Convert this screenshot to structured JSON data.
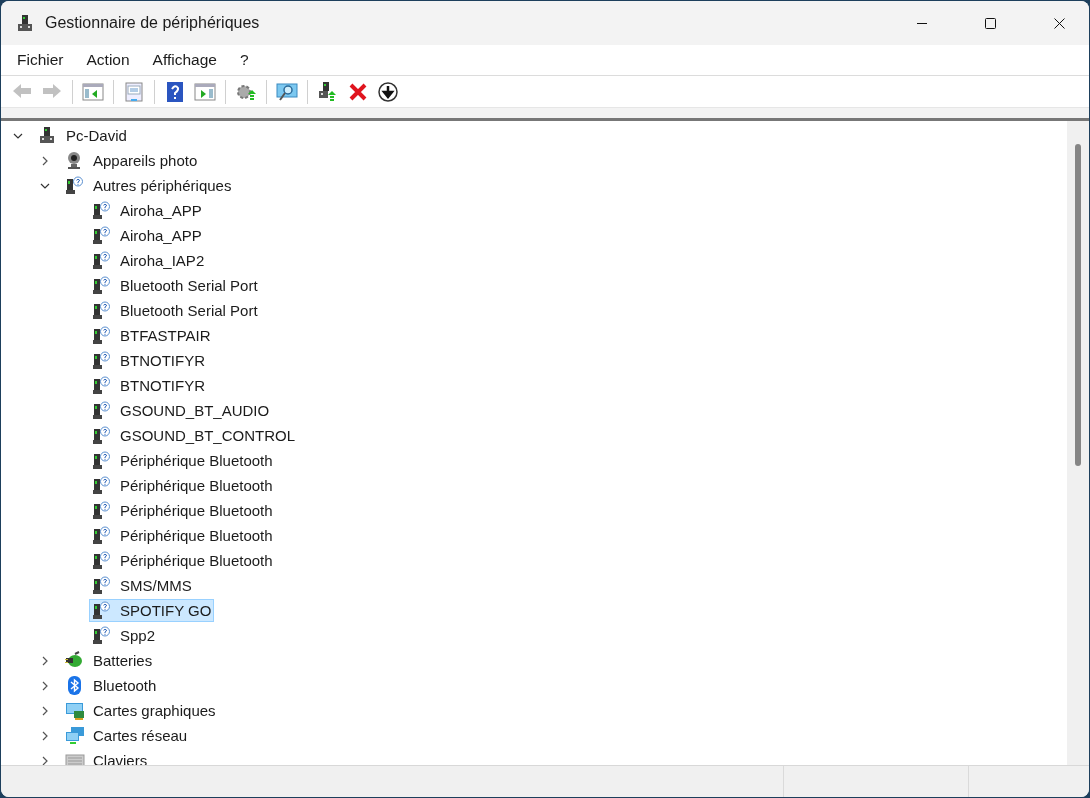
{
  "window": {
    "title": "Gestionnaire de périphériques"
  },
  "menu": [
    {
      "label": "Fichier"
    },
    {
      "label": "Action"
    },
    {
      "label": "Affichage"
    },
    {
      "label": "?"
    }
  ],
  "toolbar": [
    {
      "kind": "back",
      "disabled": true
    },
    {
      "kind": "forward",
      "disabled": true
    },
    {
      "kind": "separator"
    },
    {
      "kind": "pane-left"
    },
    {
      "kind": "separator"
    },
    {
      "kind": "properties"
    },
    {
      "kind": "separator"
    },
    {
      "kind": "help"
    },
    {
      "kind": "pane-right"
    },
    {
      "kind": "separator"
    },
    {
      "kind": "update"
    },
    {
      "kind": "separator"
    },
    {
      "kind": "scan"
    },
    {
      "kind": "separator"
    },
    {
      "kind": "enable"
    },
    {
      "kind": "remove"
    },
    {
      "kind": "download"
    }
  ],
  "tree": [
    {
      "label": "Pc-David",
      "kind": "computer",
      "expanded": true,
      "selected": false,
      "children": [
        {
          "label": "Appareils photo",
          "kind": "camera",
          "expanded": false,
          "selected": false
        },
        {
          "label": "Autres périphériques",
          "kind": "unknown",
          "expanded": true,
          "selected": false,
          "children": [
            {
              "label": "Airoha_APP",
              "kind": "unknown",
              "selected": false
            },
            {
              "label": "Airoha_APP",
              "kind": "unknown",
              "selected": false
            },
            {
              "label": "Airoha_IAP2",
              "kind": "unknown",
              "selected": false
            },
            {
              "label": "Bluetooth Serial Port",
              "kind": "unknown",
              "selected": false
            },
            {
              "label": "Bluetooth Serial Port",
              "kind": "unknown",
              "selected": false
            },
            {
              "label": "BTFASTPAIR",
              "kind": "unknown",
              "selected": false
            },
            {
              "label": "BTNOTIFYR",
              "kind": "unknown",
              "selected": false
            },
            {
              "label": "BTNOTIFYR",
              "kind": "unknown",
              "selected": false
            },
            {
              "label": "GSOUND_BT_AUDIO",
              "kind": "unknown",
              "selected": false
            },
            {
              "label": "GSOUND_BT_CONTROL",
              "kind": "unknown",
              "selected": false
            },
            {
              "label": "Périphérique Bluetooth",
              "kind": "unknown",
              "selected": false
            },
            {
              "label": "Périphérique Bluetooth",
              "kind": "unknown",
              "selected": false
            },
            {
              "label": "Périphérique Bluetooth",
              "kind": "unknown",
              "selected": false
            },
            {
              "label": "Périphérique Bluetooth",
              "kind": "unknown",
              "selected": false
            },
            {
              "label": "Périphérique Bluetooth",
              "kind": "unknown",
              "selected": false
            },
            {
              "label": "SMS/MMS",
              "kind": "unknown",
              "selected": false
            },
            {
              "label": "SPOTIFY GO",
              "kind": "unknown",
              "selected": true
            },
            {
              "label": "Spp2",
              "kind": "unknown",
              "selected": false
            }
          ]
        },
        {
          "label": "Batteries",
          "kind": "battery",
          "expanded": false,
          "selected": false
        },
        {
          "label": "Bluetooth",
          "kind": "bluetooth",
          "expanded": false,
          "selected": false
        },
        {
          "label": "Cartes graphiques",
          "kind": "display",
          "expanded": false,
          "selected": false
        },
        {
          "label": "Cartes réseau",
          "kind": "network",
          "expanded": false,
          "selected": false
        },
        {
          "label": "Claviers",
          "kind": "keyboard",
          "expanded": false,
          "selected": false
        }
      ]
    }
  ]
}
